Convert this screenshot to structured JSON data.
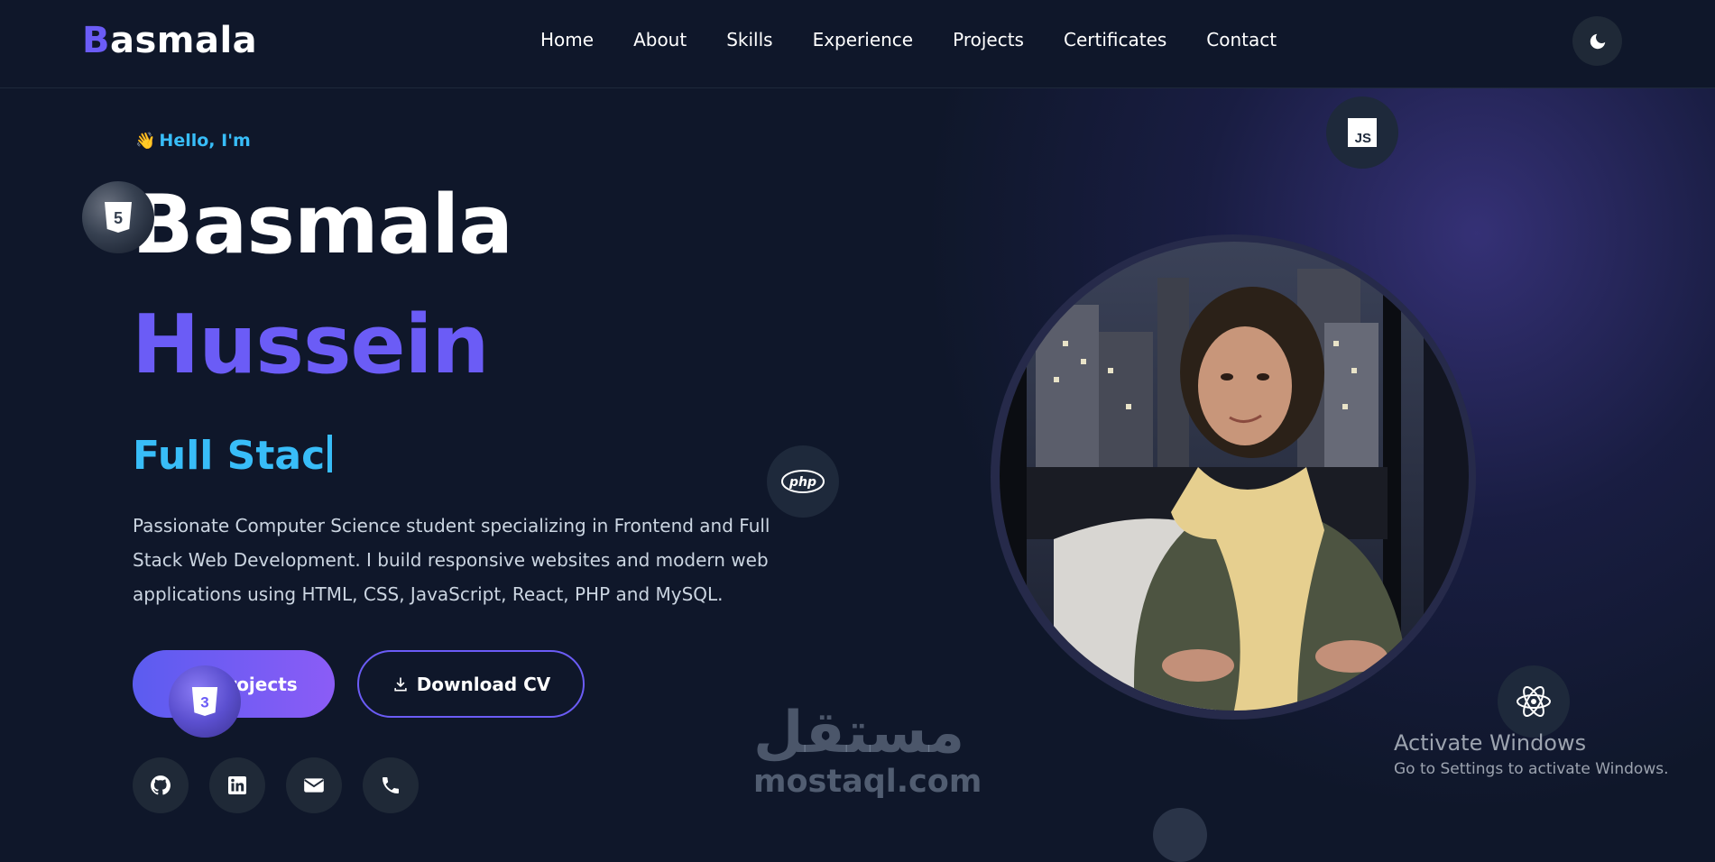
{
  "brand": {
    "first_letter": "B",
    "rest": "asmala",
    "accent": "#6b5cf6"
  },
  "nav": {
    "items": [
      {
        "label": "Home"
      },
      {
        "label": "About"
      },
      {
        "label": "Skills"
      },
      {
        "label": "Experience"
      },
      {
        "label": "Projects"
      },
      {
        "label": "Certificates"
      },
      {
        "label": "Contact"
      }
    ],
    "theme_toggle_icon": "moon-icon"
  },
  "hero": {
    "greeting": "Hello, I'm",
    "greeting_icon": "👋",
    "first_name": "Basmala",
    "last_name": "Hussein",
    "typing_text": "Full Stac",
    "description": "Passionate Computer Science student specializing in Frontend and Full Stack Web Development. I build responsive websites and modern web applications using HTML, CSS, JavaScript, React, PHP and MySQL.",
    "primary_button": "rojects",
    "secondary_button": "Download CV",
    "socials": [
      "github-icon",
      "linkedin-icon",
      "email-icon",
      "phone-icon"
    ]
  },
  "badges": {
    "html": "5",
    "css": "3",
    "js": "JS",
    "php": "php",
    "react": "react-icon"
  },
  "watermark": {
    "arabic": "مستقل",
    "latin": "mostaql.com"
  },
  "os_overlay": {
    "title": "Activate Windows",
    "subtitle": "Go to Settings to activate Windows."
  },
  "colors": {
    "background": "#0f172a",
    "accent": "#6b5cf6",
    "cyan": "#38bdf8"
  }
}
